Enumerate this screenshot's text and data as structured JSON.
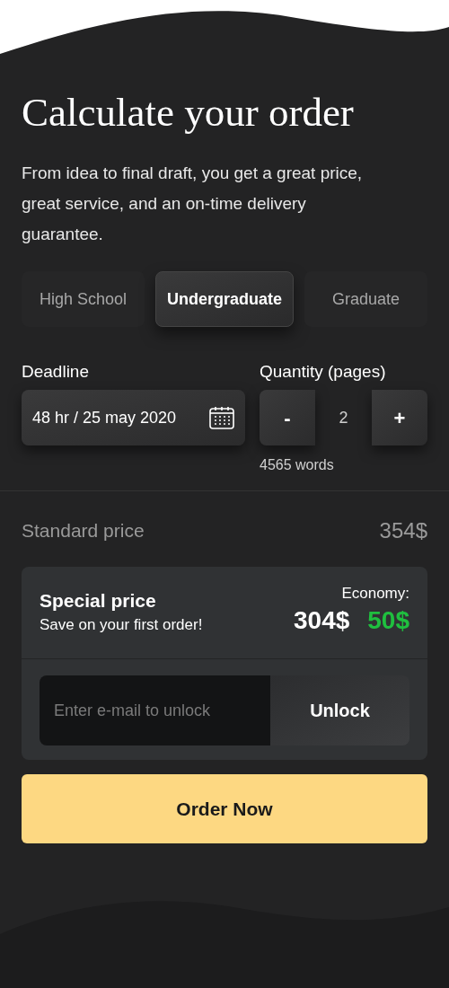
{
  "title": "Calculate your order",
  "description": "From idea to final draft, you get a great price, great service, and an on-time delivery guarantee.",
  "levels": [
    {
      "label": "High School",
      "selected": false
    },
    {
      "label": "Undergraduate",
      "selected": true
    },
    {
      "label": "Graduate",
      "selected": false
    }
  ],
  "deadline": {
    "label": "Deadline",
    "value": "48 hr / 25 may 2020"
  },
  "quantity": {
    "label": "Quantity (pages)",
    "decrement": "-",
    "value": "2",
    "increment": "+",
    "words": "4565 words"
  },
  "standard_price": {
    "label": "Standard price",
    "value": "354$"
  },
  "special_price": {
    "title": "Special price",
    "subtitle": "Save on your first order!",
    "economy_label": "Economy:",
    "price": "304$",
    "saving": "50$"
  },
  "unlock": {
    "placeholder": "Enter e-mail to unlock",
    "button": "Unlock"
  },
  "order_button": "Order Now"
}
